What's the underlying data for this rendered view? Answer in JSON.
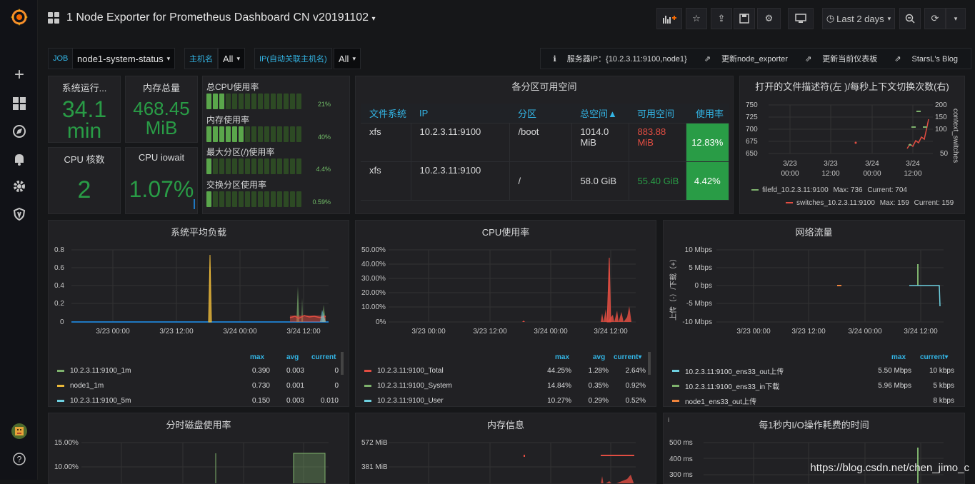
{
  "sidebar": {
    "icons": [
      "grafana-logo-icon",
      "plus-icon",
      "dashboards-icon",
      "explore-icon",
      "alerting-icon",
      "gear-icon",
      "shield-icon",
      "user-avatar-icon",
      "help-icon"
    ]
  },
  "topbar": {
    "title": "1 Node Exporter for Prometheus Dashboard CN v20191102",
    "time_range": "Last 2 days"
  },
  "variables": {
    "job_label": "JOB",
    "job_value": "node1-system-status",
    "host_label": "主机名",
    "host_value": "All",
    "ip_label": "IP(自动关联主机名)",
    "ip_value": "All"
  },
  "links": {
    "server_ip": "服务器IP：{10.2.3.11:9100,node1}",
    "update_exporter": "更新node_exporter",
    "update_dashboard": "更新当前仪表板",
    "blog": "StarsL's Blog"
  },
  "stats": {
    "uptime_title": "系统运行...",
    "uptime_value": "34.1",
    "uptime_unit": "min",
    "mem_title": "内存总量",
    "mem_value": "468.45",
    "mem_unit": "MiB",
    "cpu_cores_title": "CPU 核数",
    "cpu_cores_value": "2",
    "iowait_title": "CPU iowait",
    "iowait_value": "1.07%"
  },
  "bargauges": [
    {
      "label": "总CPU使用率",
      "value": "21%",
      "fraction": 0.21
    },
    {
      "label": "内存使用率",
      "value": "40%",
      "fraction": 0.4
    },
    {
      "label": "最大分区(/)使用率",
      "value": "4.4%",
      "fraction": 0.044
    },
    {
      "label": "交换分区使用率",
      "value": "0.59%",
      "fraction": 0.0059
    }
  ],
  "partition_table": {
    "title": "各分区可用空间",
    "headers": [
      "文件系统",
      "IP",
      "分区",
      "总空间▲",
      "可用空间",
      "使用率"
    ],
    "rows": [
      {
        "fs": "xfs",
        "ip": "10.2.3.11:9100",
        "part": "/boot",
        "total": "1014.0 MiB",
        "avail": "883.88 MiB",
        "usage": "12.83%"
      },
      {
        "fs": "xfs",
        "ip": "10.2.3.11:9100",
        "part": "/",
        "total": "58.0 GiB",
        "avail": "55.40 GiB",
        "usage": "4.42%"
      }
    ]
  },
  "fd_panel": {
    "title": "打开的文件描述符(左 )/每秒上下文切换次数(右)",
    "left_ticks": [
      "750",
      "725",
      "700",
      "675",
      "650"
    ],
    "right_ticks": [
      "200",
      "150",
      "100",
      "50"
    ],
    "right_label": "context_switches",
    "x_ticks": [
      "3/23\n00:00",
      "3/23\n12:00",
      "3/24\n00:00",
      "3/24\n12:00"
    ],
    "legend": [
      {
        "name": "filefd_10.2.3.11:9100",
        "max": "Max: 736",
        "current": "Current: 704",
        "color": "#7eb26d"
      },
      {
        "name": "switches_10.2.3.11:9100",
        "max": "Max: 159",
        "current": "Current: 159",
        "color": "#e24d42"
      }
    ]
  },
  "load_panel": {
    "title": "系统平均负载",
    "y_ticks": [
      "0.8",
      "0.6",
      "0.4",
      "0.2",
      "0"
    ],
    "x_ticks": [
      "3/23 00:00",
      "3/23 12:00",
      "3/24 00:00",
      "3/24 12:00"
    ],
    "legend_headers": [
      "max",
      "avg",
      "current"
    ],
    "legend": [
      {
        "name": "10.2.3.11:9100_1m",
        "max": "0.390",
        "avg": "0.003",
        "current": "0",
        "color": "#7eb26d"
      },
      {
        "name": "node1_1m",
        "max": "0.730",
        "avg": "0.001",
        "current": "0",
        "color": "#eab839"
      },
      {
        "name": "10.2.3.11:9100_5m",
        "max": "0.150",
        "avg": "0.003",
        "current": "0.010",
        "color": "#6ed0e0"
      }
    ]
  },
  "cpu_panel": {
    "title": "CPU使用率",
    "y_ticks": [
      "50.00%",
      "40.00%",
      "30.00%",
      "20.00%",
      "10.00%",
      "0%"
    ],
    "x_ticks": [
      "3/23 00:00",
      "3/23 12:00",
      "3/24 00:00",
      "3/24 12:00"
    ],
    "legend_headers": [
      "max",
      "avg",
      "current▾"
    ],
    "legend": [
      {
        "name": "10.2.3.11:9100_Total",
        "max": "44.25%",
        "avg": "1.28%",
        "current": "2.64%",
        "color": "#e24d42"
      },
      {
        "name": "10.2.3.11:9100_System",
        "max": "14.84%",
        "avg": "0.35%",
        "current": "0.92%",
        "color": "#7eb26d"
      },
      {
        "name": "10.2.3.11:9100_User",
        "max": "10.27%",
        "avg": "0.29%",
        "current": "0.52%",
        "color": "#6ed0e0"
      }
    ]
  },
  "net_panel": {
    "title": "网络流量",
    "y_label": "上传（-）/下载（+）",
    "y_ticks": [
      "10 Mbps",
      "5 Mbps",
      "0 bps",
      "-5 Mbps",
      "-10 Mbps"
    ],
    "x_ticks": [
      "3/23 00:00",
      "3/23 12:00",
      "3/24 00:00",
      "3/24 12:00"
    ],
    "legend_headers": [
      "max",
      "current▾"
    ],
    "legend": [
      {
        "name": "10.2.3.11:9100_ens33_out上传",
        "max": "5.50 Mbps",
        "current": "10 kbps",
        "color": "#6ed0e0"
      },
      {
        "name": "10.2.3.11:9100_ens33_in下载",
        "max": "5.96 Mbps",
        "current": "5 kbps",
        "color": "#7eb26d"
      },
      {
        "name": "node1_ens33_out上传",
        "max": "",
        "current": "8 kbps",
        "color": "#ef843c"
      }
    ]
  },
  "disk_panel": {
    "title": "分时磁盘使用率",
    "y_ticks": [
      "15.00%",
      "10.00%"
    ]
  },
  "meminfo_panel": {
    "title": "内存信息",
    "y_ticks": [
      "572 MiB",
      "381 MiB"
    ]
  },
  "io_panel": {
    "title": "每1秒内I/O操作耗费的时间",
    "info": "i",
    "y_ticks": [
      "500 ms",
      "400 ms",
      "300 ms"
    ]
  },
  "watermark": "https://blog.csdn.net/chen_jimo_c"
}
